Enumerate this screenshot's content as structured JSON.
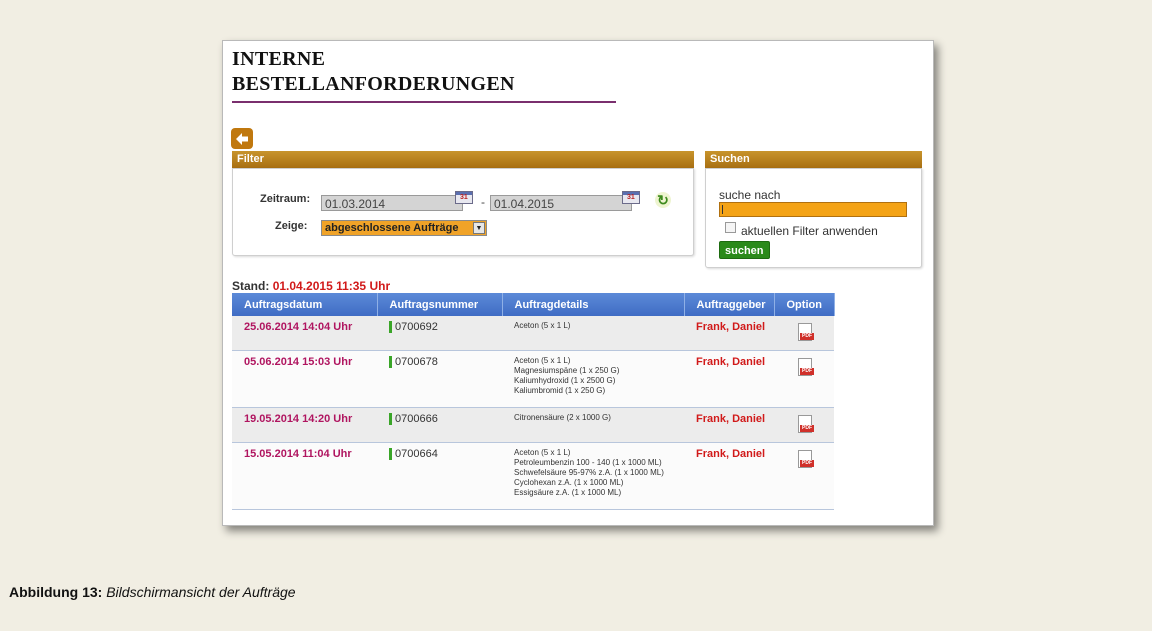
{
  "page": {
    "title_line1": "INTERNE",
    "title_line2": "BESTELLANFORDERUNGEN"
  },
  "filter": {
    "header": "Filter",
    "zeitraum_label": "Zeitraum:",
    "date_from": "01.03.2014",
    "date_separator": "-",
    "date_to": "01.04.2015",
    "zeige_label": "Zeige:",
    "zeige_value": "abgeschlossene Aufträge"
  },
  "search": {
    "header": "Suchen",
    "label": "suche nach",
    "input_value": "",
    "checkbox_label": "aktuellen Filter anwenden",
    "button_label": "suchen"
  },
  "stand": {
    "label": "Stand:",
    "value": "01.04.2015 11:35 Uhr"
  },
  "table": {
    "columns": [
      "Auftragsdatum",
      "Auftragsnummer",
      "Auftragdetails",
      "Auftraggeber",
      "Option"
    ],
    "rows": [
      {
        "date": "25.06.2014 14:04 Uhr",
        "number": "0700692",
        "details": [
          "Aceton (5 x 1 L)"
        ],
        "client": "Frank, Daniel"
      },
      {
        "date": "05.06.2014 15:03 Uhr",
        "number": "0700678",
        "details": [
          "Aceton (5 x 1 L)",
          "Magnesiumspäne (1 x 250 G)",
          "Kaliumhydroxid (1 x 2500 G)",
          "Kaliumbromid (1 x 250 G)"
        ],
        "client": "Frank, Daniel"
      },
      {
        "date": "19.05.2014 14:20 Uhr",
        "number": "0700666",
        "details": [
          "Citronensäure (2 x 1000 G)"
        ],
        "client": "Frank, Daniel"
      },
      {
        "date": "15.05.2014 11:04 Uhr",
        "number": "0700664",
        "details": [
          "Aceton (5 x 1 L)",
          "Petroleumbenzin 100 - 140 (1 x 1000 ML)",
          "Schwefelsäure 95-97% z.A. (1 x 1000 ML)",
          "Cyclohexan z.A. (1 x 1000 ML)",
          "Essigsäure z.A. (1 x 1000 ML)"
        ],
        "client": "Frank, Daniel"
      }
    ]
  },
  "caption": {
    "label": "Abbildung 13:",
    "text": "Bildschirmansicht der Aufträge"
  },
  "icons": {
    "back": "arrow-left-icon",
    "calendar": "calendar-icon",
    "refresh": "refresh-icon",
    "pdf": "pdf-icon"
  }
}
